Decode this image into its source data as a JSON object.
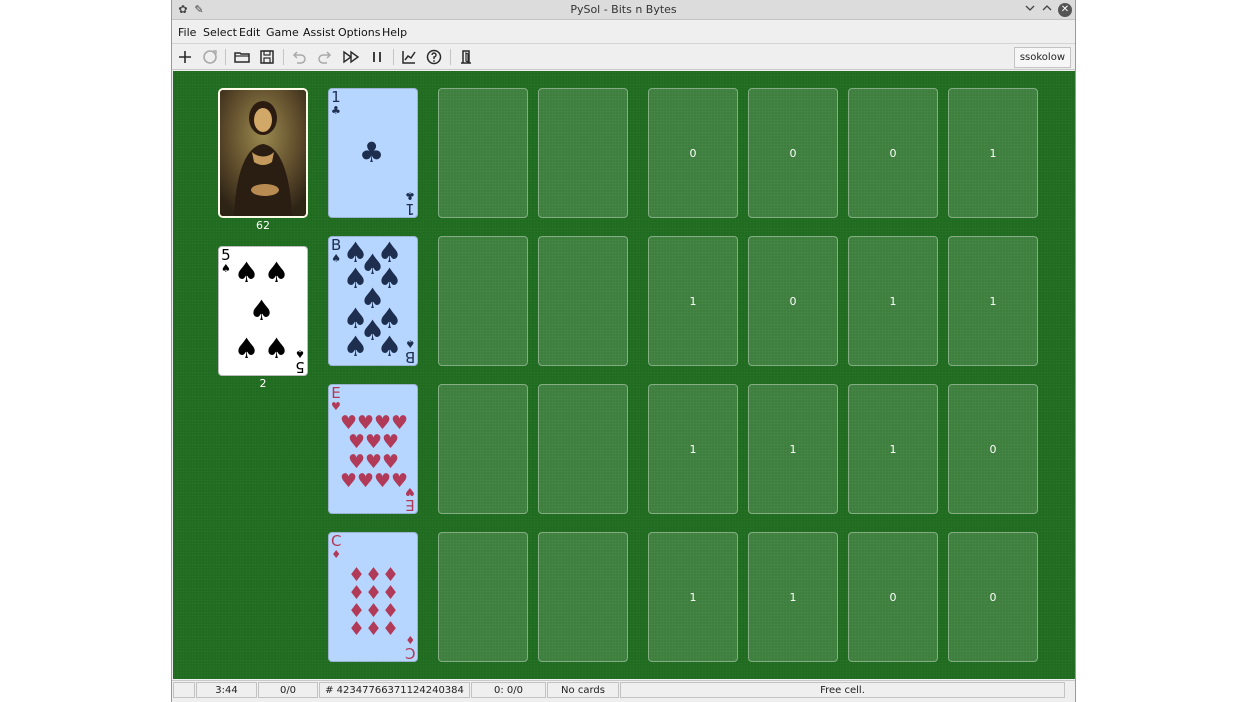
{
  "window": {
    "title": "PySol - Bits n Bytes"
  },
  "menu": [
    {
      "label": "File"
    },
    {
      "label": "Select"
    },
    {
      "label": "Edit"
    },
    {
      "label": "Game"
    },
    {
      "label": "Assist"
    },
    {
      "label": "Options"
    },
    {
      "label": "Help"
    }
  ],
  "toolbar": {
    "icons": [
      "new-game-icon",
      "restart-icon",
      "open-icon",
      "save-icon",
      "undo-icon",
      "redo-icon",
      "autodrop-icon",
      "pause-icon",
      "statistics-icon",
      "rules-icon",
      "quit-icon"
    ],
    "player": "ssokolow"
  },
  "talon": {
    "count": "62"
  },
  "waste": {
    "count": "2",
    "top_rank": "5",
    "top_suit": "♠"
  },
  "foundations": [
    {
      "rank": "1",
      "suit": "♣",
      "color": "black"
    },
    {
      "rank": "B",
      "suit": "♠",
      "color": "black"
    },
    {
      "rank": "E",
      "suit": "♥",
      "color": "red"
    },
    {
      "rank": "C",
      "suit": "♦",
      "color": "red"
    }
  ],
  "bit_counts": [
    [
      "0",
      "0",
      "0",
      "1"
    ],
    [
      "1",
      "0",
      "1",
      "1"
    ],
    [
      "1",
      "1",
      "1",
      "0"
    ],
    [
      "1",
      "1",
      "0",
      "0"
    ]
  ],
  "status": {
    "time": "3:44",
    "moves": "0/0",
    "game_number": "# 42347766371124240384",
    "score": "0: 0/0",
    "cards": "No cards",
    "message": "Free cell."
  },
  "colors": {
    "felt": "#1f6b1f",
    "card_face": "#b7d6ff",
    "red_suit": "#b03a57",
    "black_suit": "#1d2e4f"
  }
}
